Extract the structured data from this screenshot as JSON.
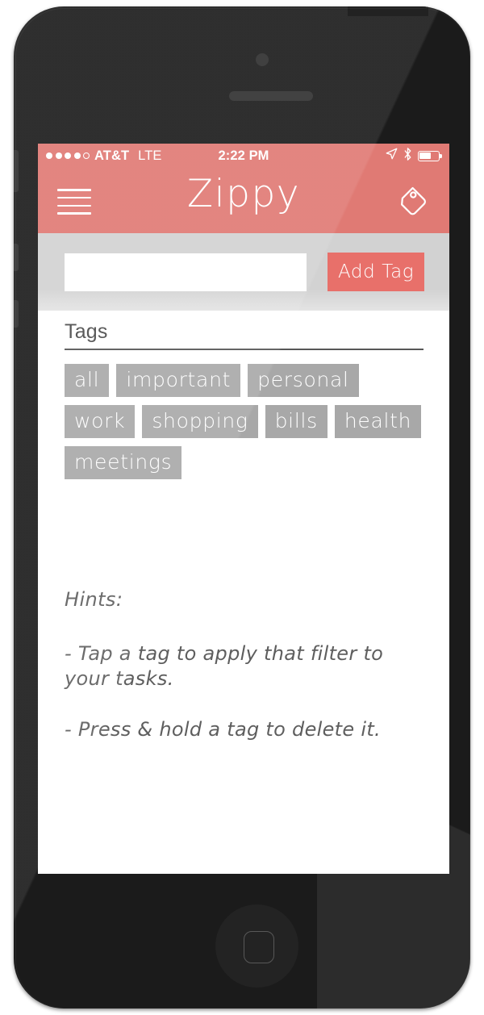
{
  "device": {
    "type": "smartphone",
    "frame_color": "#1b1b1b",
    "home_button_label": "home-button"
  },
  "status_bar": {
    "signal_dots_filled": 4,
    "signal_dots_total": 5,
    "carrier": "AT&T",
    "network": "LTE",
    "time": "2:22 PM",
    "location_icon": "location-arrow-icon",
    "bluetooth_icon": "bluetooth-icon",
    "battery_icon": "battery-icon",
    "battery_percent": 62
  },
  "nav_bar": {
    "menu_icon": "hamburger-menu-icon",
    "title": "Zippy",
    "tag_icon": "tag-icon",
    "background_color": "#e07a74"
  },
  "add_tag_bar": {
    "input_value": "",
    "input_placeholder": "",
    "button_label": "Add Tag",
    "button_color": "#e8706a",
    "background_color": "#d2d2d2"
  },
  "tags_section": {
    "heading": "Tags",
    "chip_color": "#a8a8a8",
    "tags": [
      {
        "label": "all"
      },
      {
        "label": "important"
      },
      {
        "label": "personal"
      },
      {
        "label": "work"
      },
      {
        "label": "shopping"
      },
      {
        "label": "bills"
      },
      {
        "label": "health"
      },
      {
        "label": "meetings"
      }
    ]
  },
  "hints": {
    "title": "Hints:",
    "items": [
      "- Tap a tag to apply that filter to your tasks.",
      "- Press & hold a tag to delete it."
    ]
  }
}
